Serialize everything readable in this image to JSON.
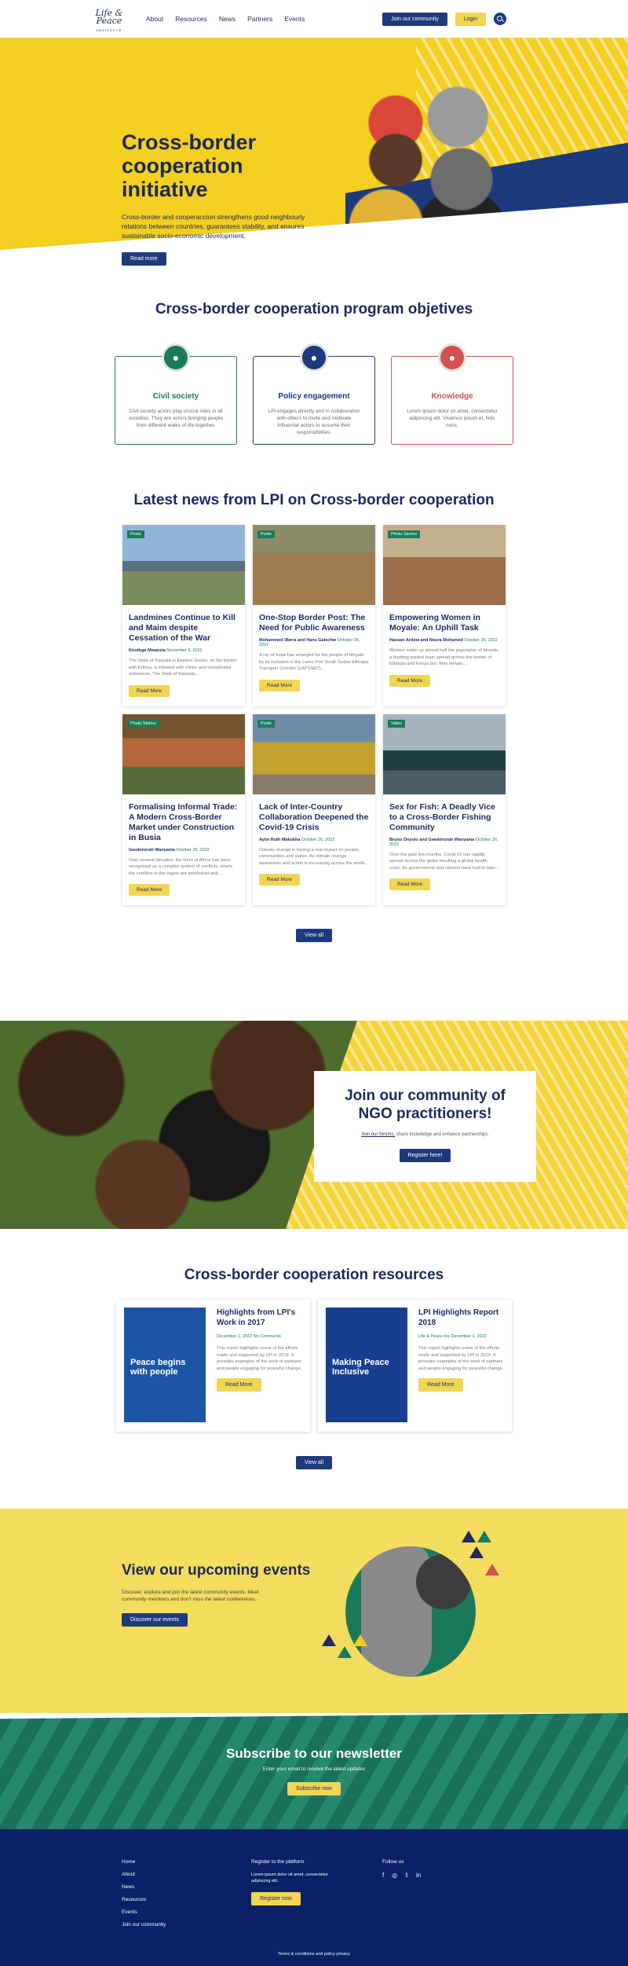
{
  "nav": {
    "logo_title": "Life & Peace",
    "logo_sub": "INSTITUTE",
    "items": [
      "About",
      "Resources",
      "News",
      "Partners",
      "Events"
    ],
    "join_label": "Join our community",
    "login_label": "Login"
  },
  "hero": {
    "title": "Cross-border cooperation initiative",
    "text": "Cross-border and cooperaccion strengthens good neighbourly relations between countries, guarantees stability, and ensures sustainable socio-economic development.",
    "button": "Read more"
  },
  "objectives": {
    "title": "Cross-border cooperation program objetives",
    "items": [
      {
        "title": "Civil society",
        "text": "Civil society actors play crucial roles in all societies. They are actors bringing people from different walks of life together.",
        "color": "#1b7b58",
        "icon": "heart-hand-icon"
      },
      {
        "title": "Policy engagement",
        "text": "LPI engages directly and in collaboration with others to invite and motivate influential actors to assume their responsibilities.",
        "color": "#1d3a7d",
        "icon": "eye-icon"
      },
      {
        "title": "Knowledge",
        "text": "Lorem ipsum dolor sit amet, consectetur adipiscing elit. Vivamus ipsum et, felis nunc.",
        "color": "#d35151",
        "icon": "head-idea-icon"
      }
    ]
  },
  "news": {
    "title": "Latest news from LPI on Cross-border cooperation",
    "cards": [
      {
        "tag": "Posts",
        "title": "Landmines Continue to Kill and Maim despite Cessation of the War",
        "author": "Kiruthga Mwanzia",
        "date": "November 9, 2022",
        "excerpt": "The State of Kassala in Eastern Sudan, on the border with Eritrea, is infested with mines and unexploded ordnances. The State of Kassala...",
        "button": "Read More",
        "img": "linear-gradient(#8fb6d8 0 45%,#55707e 45% 58%,#7b8b5e 58%)"
      },
      {
        "tag": "Posts",
        "title": "One-Stop Border Post: The Need for Public Awareness",
        "author": "Mohammed Warra and Hans Gatechw",
        "date": "October 26, 2022",
        "excerpt": "A ray of hope has emerged for the people of Moyale by its inclusion in the Lamu Port South Sudan Ethiopia Transport Corridor (LAPSSET)...",
        "button": "Read More",
        "img": "linear-gradient(#8b8d68 0 35%,#a07c51 35%)"
      },
      {
        "tag": "Photo Stories",
        "title": "Empowering Women in Moyale: An Uphill Task",
        "author": "Hassan Ardow and Noura Mohamed",
        "date": "October 26, 2022",
        "excerpt": "Women make up almost half the population of Moyale, a bustling market town spread across the border of Ethiopia and Kenya but, they remain...",
        "button": "Read More",
        "img": "linear-gradient(#c3b08d 0 40%,#9c6b4a 40%)"
      },
      {
        "tag": "Photo Stories",
        "title": "Formalising Informal Trade: A Modern Cross-Border Market under Construction in Busia",
        "author": "Gwokinorah Wanyama",
        "date": "October 26, 2022",
        "excerpt": "Over several decades, the Horn of Africa has been recognised as a complex system of conflicts, where the conflicts in the region are interlinked and...",
        "button": "Read More",
        "img": "linear-gradient(#77532f 0 30%,#b3673c 30% 65%,#5a6b3a 65%)"
      },
      {
        "tag": "Posts",
        "title": "Lack of Inter-Country Collaboration Deepened the Covid-19 Crisis",
        "author": "Ayim Ruth Makokha",
        "date": "October 26, 2022",
        "excerpt": "Climate change is having a real impact on people, communities and states. As climate change awareness and action is increasing across the world...",
        "button": "Read More",
        "img": "linear-gradient(#6e8ca8 0 35%,#c4a02d 35% 75%,#8b7b6a 75%)"
      },
      {
        "tag": "Video",
        "title": "Sex for Fish: A Deadly Vice to a Cross-Border Fishing Community",
        "author": "Bruno Onyolo and Gwokinorah Wanyama",
        "date": "October 26, 2022",
        "excerpt": "Over the past few months, Covid-19 has rapidly spread across the globe resulting a global health crisis. As governments and citizens have had to take...",
        "button": "Read More",
        "img": "linear-gradient(#a3b3c0 0 45%,#1f3d44 45% 70%,#4a5c65 70%)"
      }
    ],
    "view_all": "View all"
  },
  "join": {
    "title": "Join our community of NGO practitioners!",
    "link": "Join our forums,",
    "text": " share knowledge and enhance partnerships.",
    "button": "Register here!"
  },
  "resources": {
    "title": "Cross-border cooperation resources",
    "items": [
      {
        "cover": "Peace begins with people",
        "title": "Highlights from LPI's Work in 2017",
        "meta": "December 1, 2022 No Comments",
        "text": "This report highlights some of the efforts made and supported by LPI in 2018. It provides examples of the work of partners and people engaging for peaceful change.",
        "button": "Read More"
      },
      {
        "cover": "Making Peace Inclusive",
        "title": "LPI Highlights Report 2018",
        "meta": "Life & Peace Ins December 1, 2022",
        "text": "This report highlights some of the efforts made and supported by LPI in 2019. It provides examples of the work of partners and people engaging for peaceful change.",
        "button": "Read More"
      }
    ],
    "view_all": "View all"
  },
  "events": {
    "title": "View our upcoming events",
    "text": "Discover, explore and join the latest community events. Meet community members and don't miss the latest conferences.",
    "button": "Discover our events"
  },
  "subscribe": {
    "title": "Subscribe to our newsletter",
    "text": "Enter your email to receive the latest updates",
    "button": "Subscribe now"
  },
  "footer": {
    "links": [
      "Home",
      "About",
      "News",
      "Resources",
      "Events",
      "Join our community"
    ],
    "register_title": "Register to the platform",
    "register_text": "Lorem ipsum dolor sit amet, consectetur adipiscing elit.",
    "register_button": "Register now",
    "follow": "Follow us",
    "social": [
      "f",
      "◎",
      "𝕥",
      "in"
    ],
    "terms": "Terms & conditions and policy privacy"
  }
}
